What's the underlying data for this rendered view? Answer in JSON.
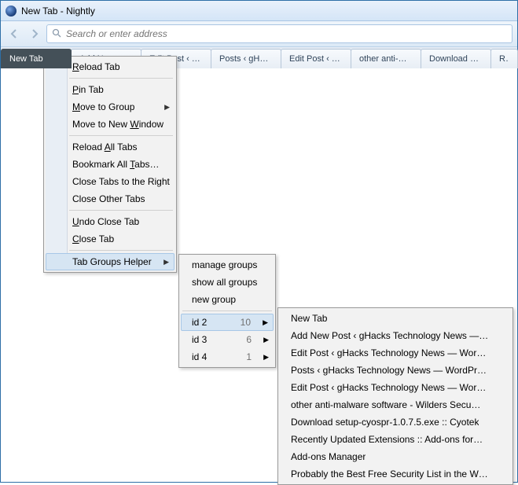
{
  "window_title": "New Tab - Nightly",
  "addressbar": {
    "placeholder": "Search or enter address"
  },
  "tabs": [
    "New Tab",
    "Add New …",
    "Edit Post ‹ g…",
    "Posts ‹ gHa…",
    "Edit Post ‹ g…",
    "other anti-…",
    "Download s…",
    "Re"
  ],
  "ctx": {
    "reload": "Reload Tab",
    "pin": "Pin Tab",
    "move_group": "Move to Group",
    "move_window": "Move to New Window",
    "reload_all": "Reload All Tabs",
    "bookmark_all": "Bookmark All Tabs…",
    "close_right": "Close Tabs to the Right",
    "close_other": "Close Other Tabs",
    "undo_close": "Undo Close Tab",
    "close_tab": "Close Tab",
    "helper": "Tab Groups Helper"
  },
  "helper_sub": {
    "manage": "manage groups",
    "showall": "show all groups",
    "newgrp": "new group",
    "groups": [
      {
        "name": "id 2",
        "count": "10"
      },
      {
        "name": "id 3",
        "count": "6"
      },
      {
        "name": "id 4",
        "count": "1"
      }
    ]
  },
  "group_tabs": [
    "New Tab",
    "Add New Post ‹ gHacks Technology News —…",
    "Edit Post ‹ gHacks Technology News — Wor…",
    "Posts ‹ gHacks Technology News — WordPr…",
    "Edit Post ‹ gHacks Technology News — Wor…",
    "other anti-malware software - Wilders Secu…",
    "Download setup-cyospr-1.0.7.5.exe :: Cyotek",
    "Recently Updated Extensions :: Add-ons for…",
    "Add-ons Manager",
    "Probably the Best Free Security List in the W…"
  ]
}
